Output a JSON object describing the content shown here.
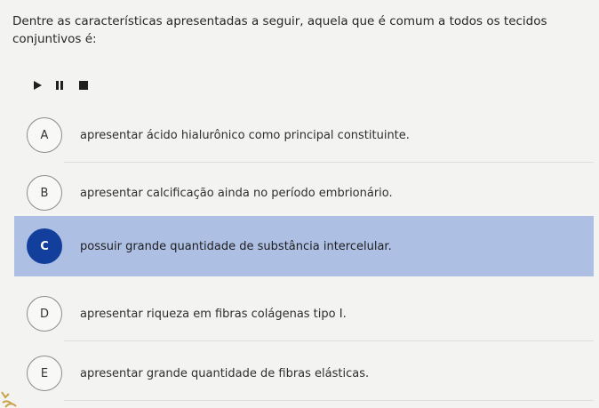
{
  "question": {
    "text": "Dentre as características apresentadas a seguir, aquela que é comum a todos os tecidos conjuntivos é:"
  },
  "audio": {
    "play_icon": "play-icon",
    "pause_icon": "pause-icon",
    "stop_icon": "stop-icon"
  },
  "options": [
    {
      "letter": "A",
      "text": "apresentar ácido hialurônico como principal constituinte.",
      "selected": false
    },
    {
      "letter": "B",
      "text": "apresentar calcificação ainda no período embrionário.",
      "selected": false
    },
    {
      "letter": "C",
      "text": "possuir grande quantidade de substância intercelular.",
      "selected": true
    },
    {
      "letter": "D",
      "text": "apresentar riqueza em fibras colágenas tipo I.",
      "selected": false
    },
    {
      "letter": "E",
      "text": "apresentar grande quantidade de fibras elásticas.",
      "selected": false
    }
  ],
  "colors": {
    "selected_background": "#aebfe4",
    "selected_badge": "#123f9c"
  }
}
